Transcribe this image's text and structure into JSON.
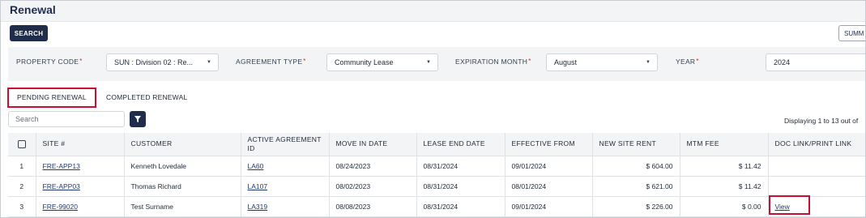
{
  "page": {
    "title": "Renewal"
  },
  "toolbar": {
    "search_label": "SEARCH",
    "summary_label": "SUMM"
  },
  "filters": {
    "property_code": {
      "label": "PROPERTY CODE",
      "value": "SUN : Division 02 : Re..."
    },
    "agreement_type": {
      "label": "AGREEMENT TYPE",
      "value": "Community Lease"
    },
    "expiration_month": {
      "label": "EXPIRATION MONTH",
      "value": "August"
    },
    "year": {
      "label": "YEAR",
      "value": "2024"
    }
  },
  "tabs": [
    {
      "label": "PENDING RENEWAL",
      "active": true
    },
    {
      "label": "COMPLETED RENEWAL",
      "active": false
    }
  ],
  "search": {
    "placeholder": "Search"
  },
  "displaying": "Displaying 1 to 13 out of",
  "colors": {
    "primary": "#1f2d4a",
    "highlight": "#c8102e",
    "required": "#dc2626"
  },
  "table": {
    "columns": [
      "",
      "SITE #",
      "CUSTOMER",
      "ACTIVE AGREEMENT ID",
      "MOVE IN DATE",
      "LEASE END DATE",
      "EFFECTIVE FROM",
      "NEW SITE RENT",
      "MTM FEE",
      "DOC LINK/PRINT LINK"
    ],
    "rows": [
      {
        "no": "1",
        "site": "FRE-APP13",
        "customer": "Kenneth Lovedale",
        "agreement": "LA60",
        "move_in": "08/24/2023",
        "lease_end": "08/31/2024",
        "effective": "09/01/2024",
        "rent": "$ 604.00",
        "mtm": "$ 11.42",
        "doc": ""
      },
      {
        "no": "2",
        "site": "FRE-APP03",
        "customer": "Thomas Richard",
        "agreement": "LA107",
        "move_in": "08/02/2023",
        "lease_end": "08/31/2024",
        "effective": "08/01/2024",
        "rent": "$ 621.00",
        "mtm": "$ 11.42",
        "doc": ""
      },
      {
        "no": "3",
        "site": "FRE-99020",
        "customer": "Test Surname",
        "agreement": "LA319",
        "move_in": "08/08/2023",
        "lease_end": "08/31/2024",
        "effective": "09/01/2024",
        "rent": "$ 226.00",
        "mtm": "$ 0.00",
        "doc": "View"
      }
    ]
  }
}
